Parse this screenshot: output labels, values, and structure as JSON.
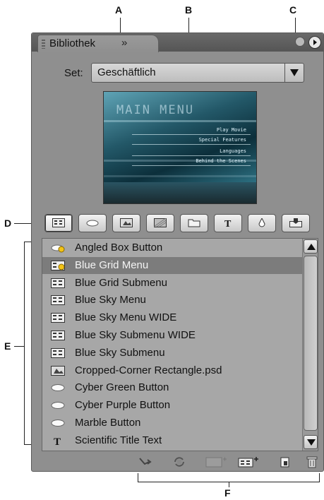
{
  "callouts": [
    "A",
    "B",
    "C",
    "D",
    "E",
    "F"
  ],
  "panel": {
    "tab_label": "Bibliothek",
    "tab_close": "»",
    "set_label": "Set:",
    "set_value": "Geschäftlich",
    "icons": {
      "menu": "panel-menu-icon",
      "collapse": "collapse-icon",
      "grip": "grip-icon"
    }
  },
  "preview": {
    "title": "MAIN MENU",
    "items": [
      "Play Movie",
      "Special Features",
      "Languages",
      "Behind the Scenes"
    ]
  },
  "filters": [
    {
      "name": "menus",
      "icon": "menu-icon",
      "selected": true
    },
    {
      "name": "buttons",
      "icon": "button-icon"
    },
    {
      "name": "images",
      "icon": "image-icon"
    },
    {
      "name": "backgrounds",
      "icon": "background-icon"
    },
    {
      "name": "layouts",
      "icon": "layout-icon"
    },
    {
      "name": "text",
      "icon": "text-icon"
    },
    {
      "name": "effects",
      "icon": "effect-icon"
    },
    {
      "name": "submenus",
      "icon": "import-icon"
    }
  ],
  "list": {
    "items": [
      {
        "label": "Angled Box Button",
        "icon": "button-star-icon"
      },
      {
        "label": "Blue Grid Menu",
        "icon": "menu-star-icon",
        "selected": true
      },
      {
        "label": "Blue Grid Submenu",
        "icon": "menu-icon"
      },
      {
        "label": "Blue Sky Menu",
        "icon": "menu-icon"
      },
      {
        "label": "Blue Sky Menu WIDE",
        "icon": "menu-icon"
      },
      {
        "label": "Blue Sky Submenu WIDE",
        "icon": "menu-icon"
      },
      {
        "label": "Blue Sky Submenu",
        "icon": "menu-icon"
      },
      {
        "label": "Cropped-Corner Rectangle.psd",
        "icon": "image-icon"
      },
      {
        "label": "Cyber Green Button",
        "icon": "button-icon"
      },
      {
        "label": "Cyber Purple Button",
        "icon": "button-icon"
      },
      {
        "label": "Marble Button",
        "icon": "button-icon"
      },
      {
        "label": "Scientific Title Text",
        "icon": "text-icon"
      }
    ]
  },
  "bottom_buttons": [
    "place-icon",
    "replace-icon",
    "add-to-menu-icon",
    "new-submenu-icon",
    "new-item-icon",
    "delete-icon"
  ],
  "colors": {
    "panel_bg": "#8f8f8f",
    "list_bg": "#a7a7a7",
    "selected_bg": "#7c7c7c"
  }
}
